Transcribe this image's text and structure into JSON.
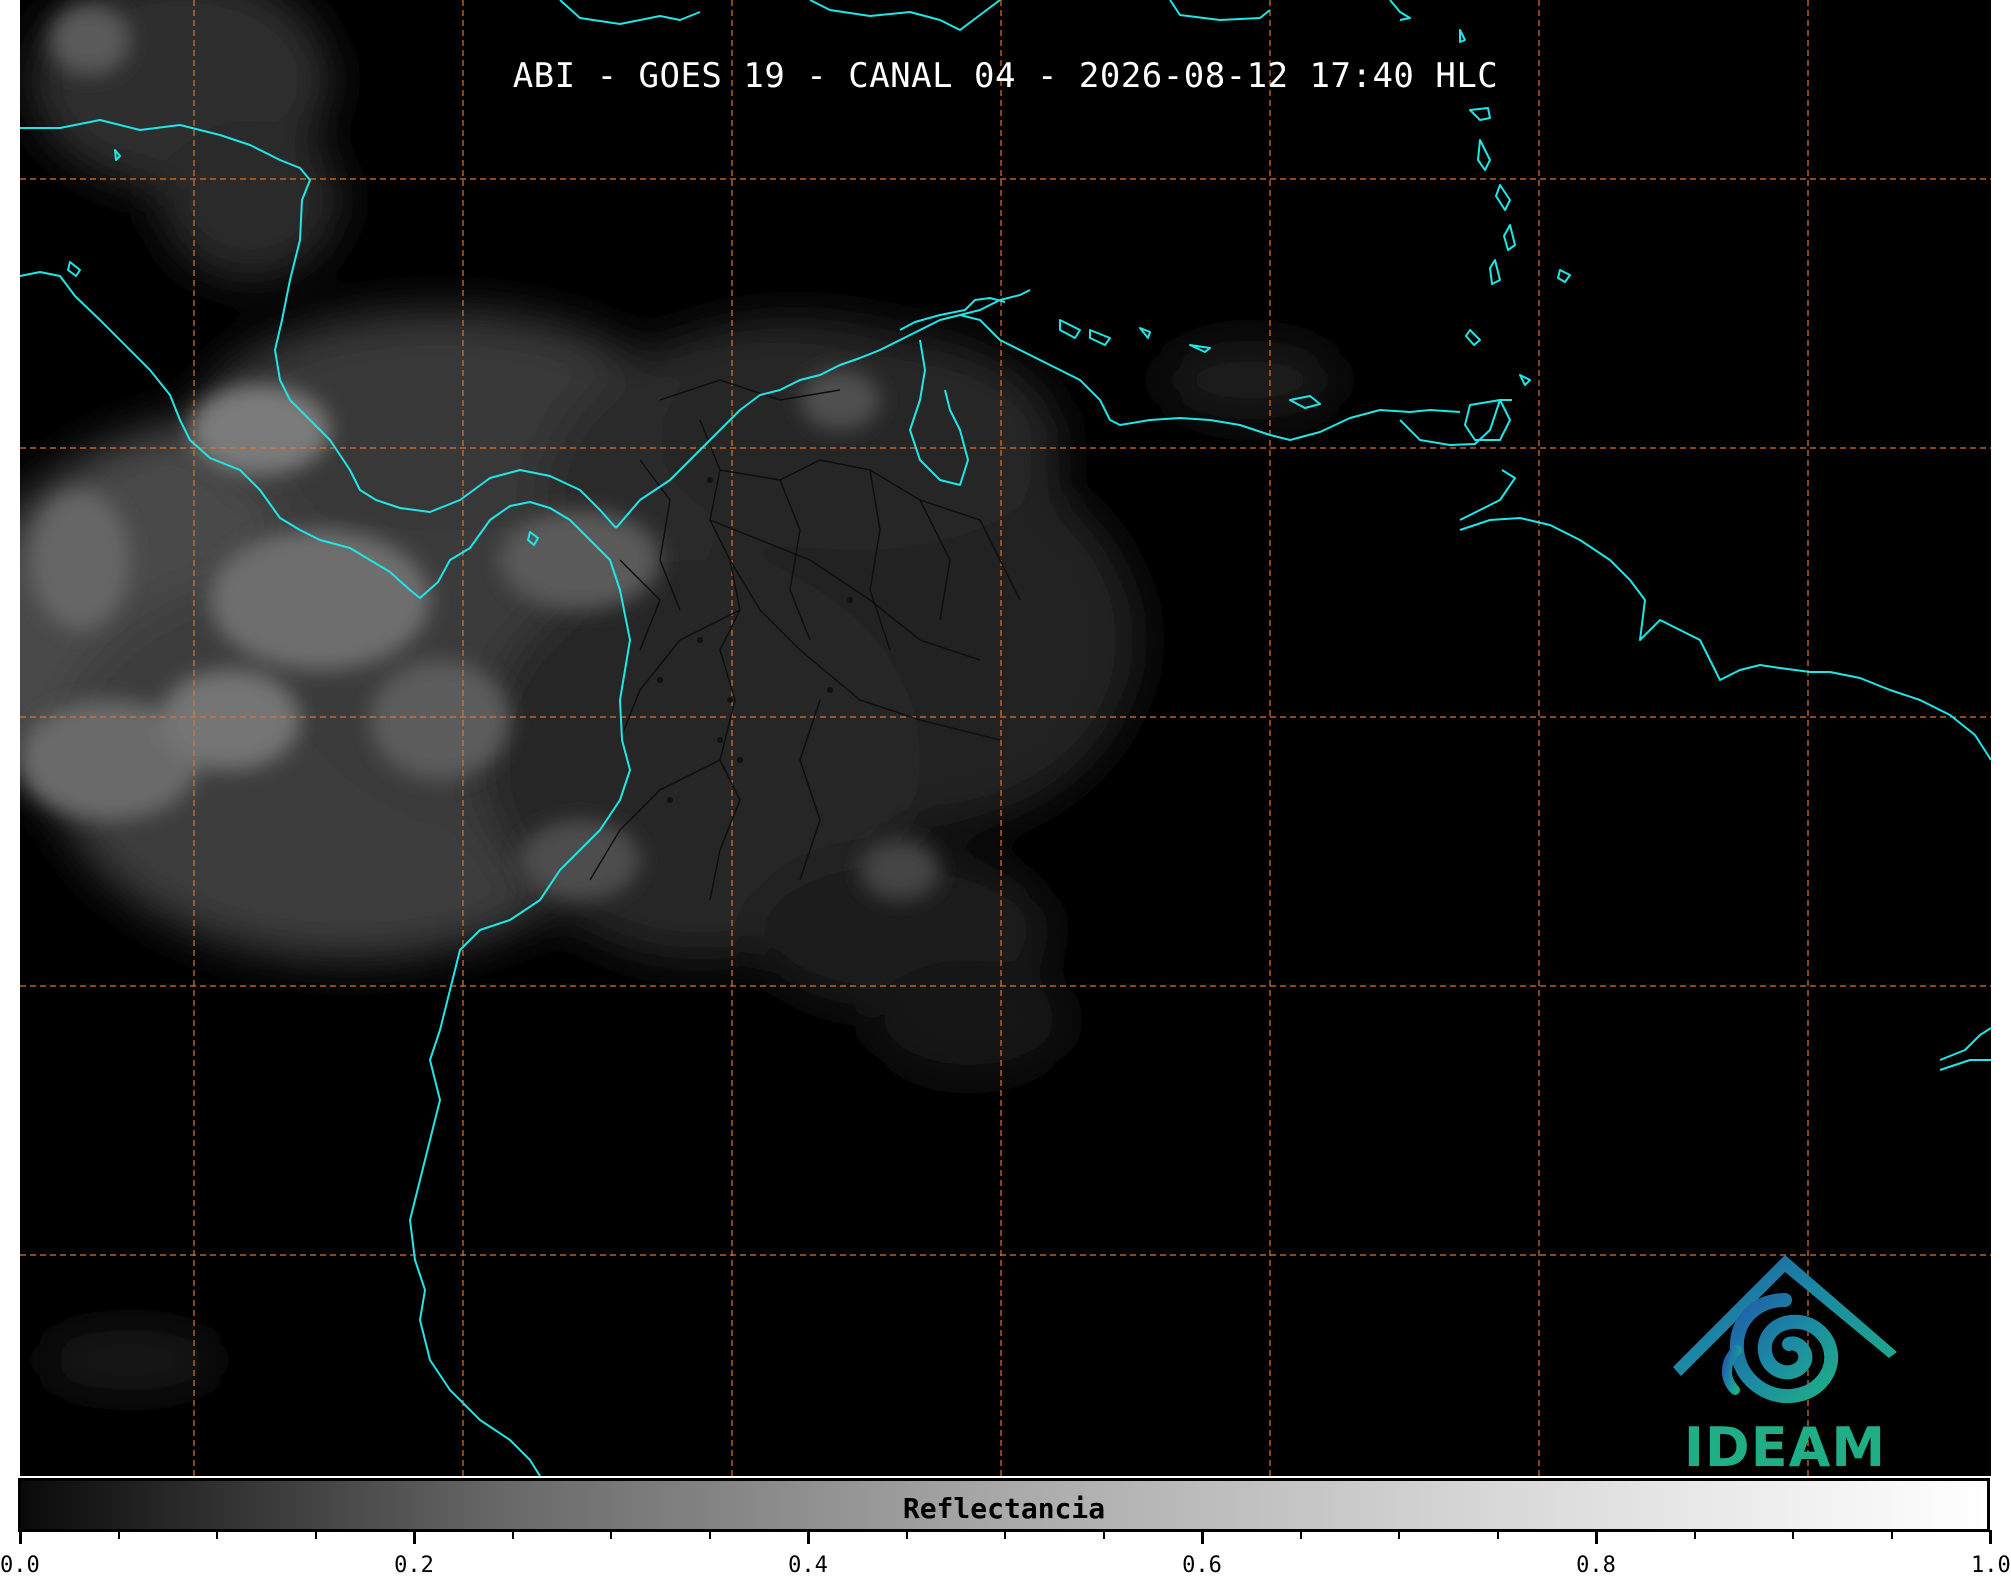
{
  "title": "ABI - GOES 19 - CANAL 04 - 2026-08-12 17:40 HLC",
  "logo": {
    "text": "IDEAM",
    "icon": "ideam-logo-icon"
  },
  "colorbar": {
    "label": "Reflectancia",
    "range": [
      0.0,
      1.0
    ],
    "colors": [
      "#0a0a0a",
      "#6a6a6a",
      "#a9a9a9",
      "#d8d8d8",
      "#ffffff"
    ],
    "ticks": [
      "0.0",
      "0.2",
      "0.4",
      "0.6",
      "0.8",
      "1.0"
    ]
  },
  "map_style": {
    "coastline_color": "#1fe7e7",
    "grid_color": "#e0742b",
    "background_color": "#000000",
    "grid": "on"
  }
}
